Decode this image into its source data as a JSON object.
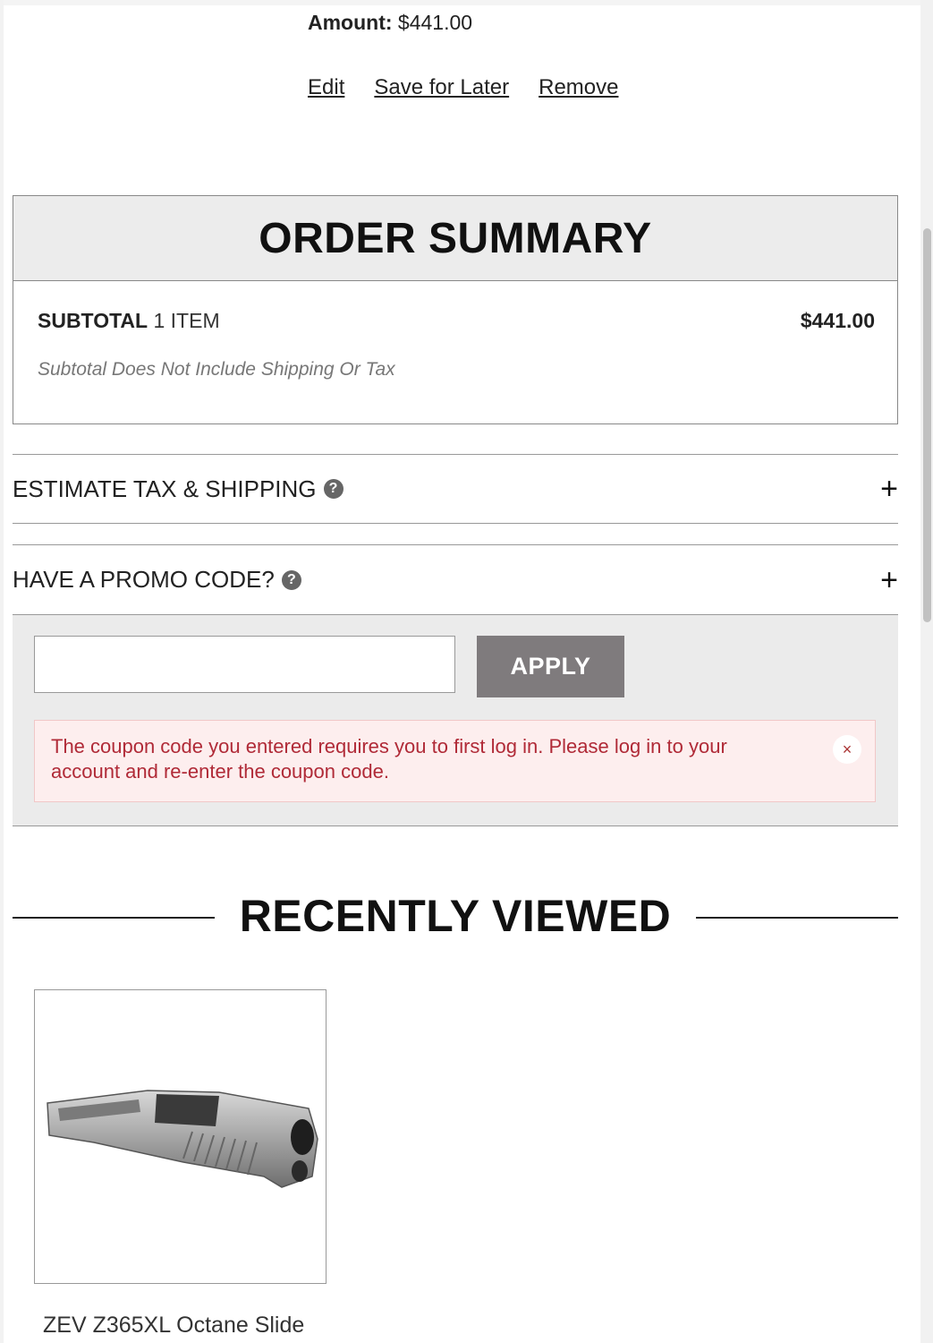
{
  "cart_item": {
    "amount_label": "Amount:",
    "amount_value": "$441.00",
    "actions": {
      "edit": "Edit",
      "save_for_later": "Save for Later",
      "remove": "Remove"
    }
  },
  "order_summary": {
    "title": "ORDER SUMMARY",
    "subtotal_label": "SUBTOTAL",
    "item_count": "1 ITEM",
    "subtotal_value": "$441.00",
    "note": "Subtotal Does Not Include Shipping Or Tax"
  },
  "estimate": {
    "label": "ESTIMATE TAX & SHIPPING",
    "help_icon": "question-circle-icon",
    "toggle": "+"
  },
  "promo": {
    "label": "HAVE A PROMO CODE?",
    "help_icon": "question-circle-icon",
    "toggle": "+",
    "input_value": "",
    "apply_label": "APPLY",
    "error_message": "The coupon code you entered requires you to first log in. Please log in to your account and re-enter the coupon code.",
    "close_glyph": "×"
  },
  "recently_viewed": {
    "title": "RECENTLY VIEWED",
    "items": [
      {
        "name": "ZEV Z365XL Octane Slide",
        "image": "pistol-slide-image"
      }
    ]
  },
  "colors": {
    "apply_button": "#7f7b7d",
    "error_text": "#b02a37",
    "error_bg": "#fdeeee",
    "panel_bg": "#ebebeb"
  }
}
